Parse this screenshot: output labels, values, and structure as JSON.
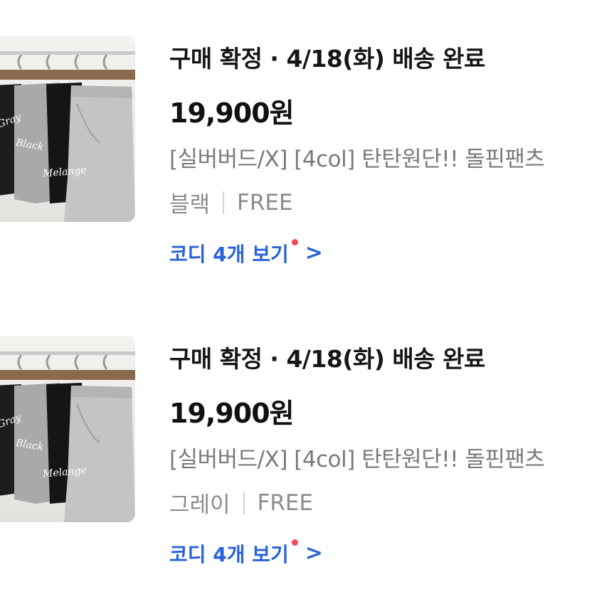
{
  "orders": [
    {
      "status": "구매 확정 · 4/18(화) 배송 완료",
      "price": "19,900원",
      "product_name": "[실버버드/X] [4col] 탄탄원단!! 돌핀팬츠",
      "option_color": "블랙",
      "option_size": "FREE",
      "coordi_link": "코디 4개 보기",
      "thumb_tags": [
        "Gray",
        "Black",
        "Melange"
      ]
    },
    {
      "status": "구매 확정 · 4/18(화) 배송 완료",
      "price": "19,900원",
      "product_name": "[실버버드/X] [4col] 탄탄원단!! 돌핀팬츠",
      "option_color": "그레이",
      "option_size": "FREE",
      "coordi_link": "코디 4개 보기",
      "thumb_tags": [
        "Gray",
        "Black",
        "Melange"
      ]
    }
  ],
  "icons": {
    "new_dot": "notification-dot-icon",
    "chevron": "chevron-right-icon",
    "chevron_glyph": ">"
  },
  "colors": {
    "link": "#2a62d8",
    "new_dot": "#f0475a",
    "secondary_text": "#7a7a7a"
  }
}
